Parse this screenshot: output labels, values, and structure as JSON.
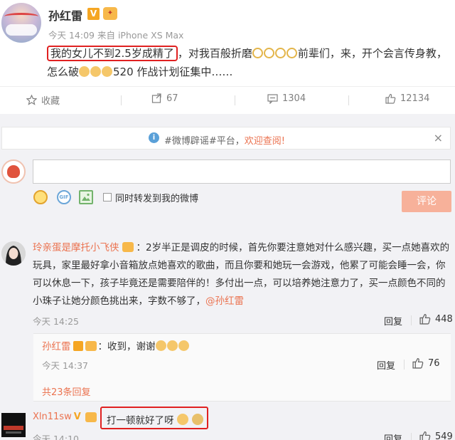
{
  "post": {
    "author": "孙红雷",
    "verified_badge": "V",
    "crown_badge": "👑",
    "time": "今天 14:09",
    "source": "来自 iPhone XS Max",
    "text_highlight": "我的女儿不到2.5岁成精了",
    "text_rest_1": "，对我百般折磨",
    "text_rest_2": "前辈们，来，开个会言传身教，怎么破",
    "text_rest_3": "520 作战计划征集中……"
  },
  "actions": {
    "favorite_label": "收藏",
    "repost_count": "67",
    "comment_count": "1304",
    "like_count": "12134"
  },
  "notice": {
    "prefix": "#微博辟谣#平台，",
    "link": "欢迎查阅!",
    "close": "×"
  },
  "composer": {
    "input_placeholder": "",
    "forward_label": "同时转发到我的微博",
    "submit_label": "评论",
    "gif_label": "GIF"
  },
  "comments": [
    {
      "name": "玲亲蛋是摩托小飞侠",
      "text": "：2岁半正是调皮的时候，首先你要注意她对什么感兴趣，买一点她喜欢的玩具，家里最好拿小音箱放点她喜欢的歌曲，而且你要和她玩一会游戏，他累了可能会睡一会，你可以休息一下，孩子毕竟还是需要陪伴的！多付出一点，可以培养她注意力了，买一点颜色不同的小珠子让她分颜色挑出来，字数不够了，",
      "mention": "@孙红雷",
      "time": "今天 14:25",
      "reply_label": "回复",
      "likes": "448"
    },
    {
      "name": "Xln11sw",
      "text": "打一顿就好了呀",
      "time": "今天 14:10",
      "reply_label": "回复",
      "likes": "549"
    }
  ],
  "subreply": {
    "name": "孙红雷",
    "text": "：收到，谢谢",
    "time": "今天 14:37",
    "reply_label": "回复",
    "likes": "76",
    "more_label": "共23条回复"
  },
  "colors": {
    "accent": "#eb7350",
    "highlight_box": "#e02020",
    "muted": "#999999"
  }
}
